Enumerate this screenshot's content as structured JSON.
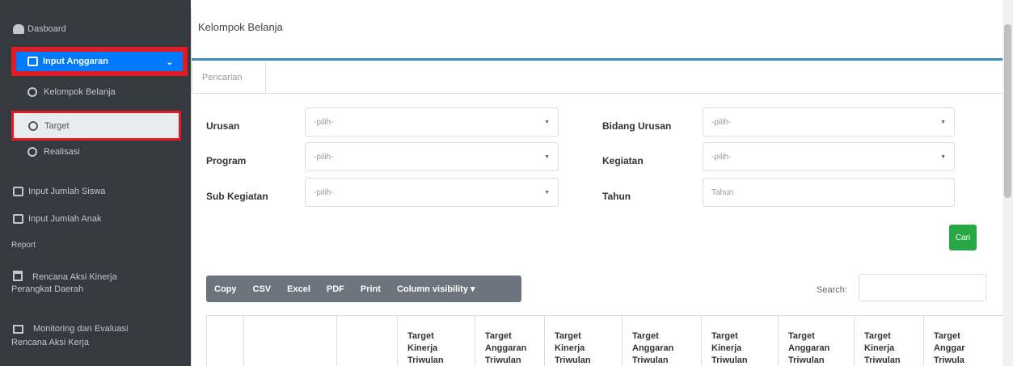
{
  "sidebar": {
    "dashboard": "Dasboard",
    "input_anggaran": "Input Anggaran",
    "kelompok_belanja": "Kelompok Belanja",
    "target": "Target",
    "realisasi": "Realisasi",
    "input_jumlah_siswa": "Input Jumlah Siswa",
    "input_jumlah_anak": "Input Jumlah Anak",
    "report_header": "Report",
    "rencana_line1": "Rencana Aksi Kinerja",
    "rencana_line2": "Perangkat Daerah",
    "monev_line1": "Monitoring dan Evaluasi",
    "monev_line2": "Rencana Aksi Kerja"
  },
  "card": {
    "title": "Kelompok Belanja",
    "tab": "Pencarian"
  },
  "form": {
    "urusan_label": "Urusan",
    "urusan_value": "-pilih-",
    "bidang_label": "Bidang Urusan",
    "bidang_value": "-pilih-",
    "program_label": "Program",
    "program_value": "-pilih-",
    "kegiatan_label": "Kegiatan",
    "kegiatan_value": "-pilih-",
    "subkegiatan_label": "Sub Kegiatan",
    "subkegiatan_value": "-pilih-",
    "tahun_label": "Tahun",
    "tahun_placeholder": "Tahun",
    "cari_button": "Cari"
  },
  "toolbar": {
    "copy": "Copy",
    "csv": "CSV",
    "excel": "Excel",
    "pdf": "PDF",
    "print": "Print",
    "colvis": "Column visibility ▾",
    "search_label": "Search:"
  },
  "table": {
    "headers": [
      [
        "Target",
        "Kinerja",
        "Triwulan"
      ],
      [
        "Target",
        "Anggaran",
        "Triwulan"
      ],
      [
        "Target",
        "Kinerja",
        "Triwulan"
      ],
      [
        "Target",
        "Anggaran",
        "Triwulan"
      ],
      [
        "Target",
        "Kinerja",
        "Triwulan"
      ],
      [
        "Target",
        "Anggaran",
        "Triwulan"
      ],
      [
        "Target",
        "Kinerja",
        "Triwulan"
      ],
      [
        "Target",
        "Anggar",
        "Triwula"
      ]
    ]
  },
  "colors": {
    "sidebar_bg": "#343a40",
    "active_blue": "#007bff",
    "highlight_red": "#e01b24",
    "cari_green": "#28a745"
  }
}
